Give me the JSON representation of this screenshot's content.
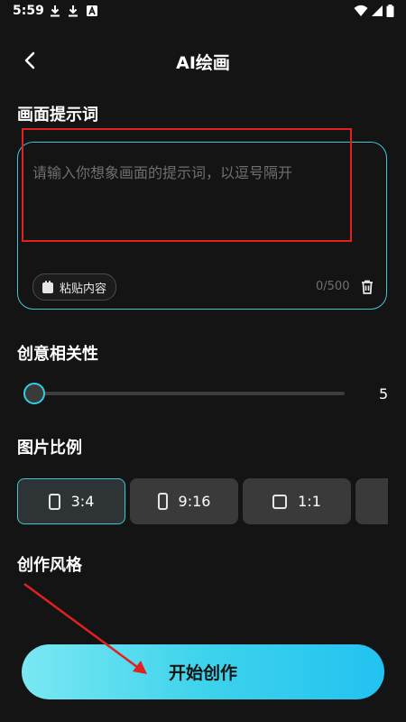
{
  "status_bar": {
    "time": "5:59",
    "left_icons": [
      "download-icon",
      "download-icon",
      "app-a-icon"
    ],
    "right_icons": [
      "wifi-icon",
      "signal-icon",
      "battery-icon"
    ]
  },
  "header": {
    "title": "AI绘画",
    "back_icon": "chevron-left-icon"
  },
  "prompt": {
    "section_title": "画面提示词",
    "placeholder": "请输入你想象画面的提示词，以逗号隔开",
    "paste_label": "粘贴内容",
    "counter": "0/500",
    "trash_icon": "trash-icon"
  },
  "relevance": {
    "section_title": "创意相关性",
    "value": "5",
    "slider_fraction": 0
  },
  "ratio": {
    "section_title": "图片比例",
    "options": [
      {
        "label": "3:4",
        "selected": true
      },
      {
        "label": "9:16",
        "selected": false
      },
      {
        "label": "1:1",
        "selected": false
      },
      {
        "label": "",
        "selected": false
      }
    ]
  },
  "style": {
    "section_title": "创作风格"
  },
  "start_button": {
    "label": "开始创作"
  },
  "colors": {
    "accent": "#3cc7d7",
    "background": "#141414",
    "annotation_red": "#e02121"
  }
}
